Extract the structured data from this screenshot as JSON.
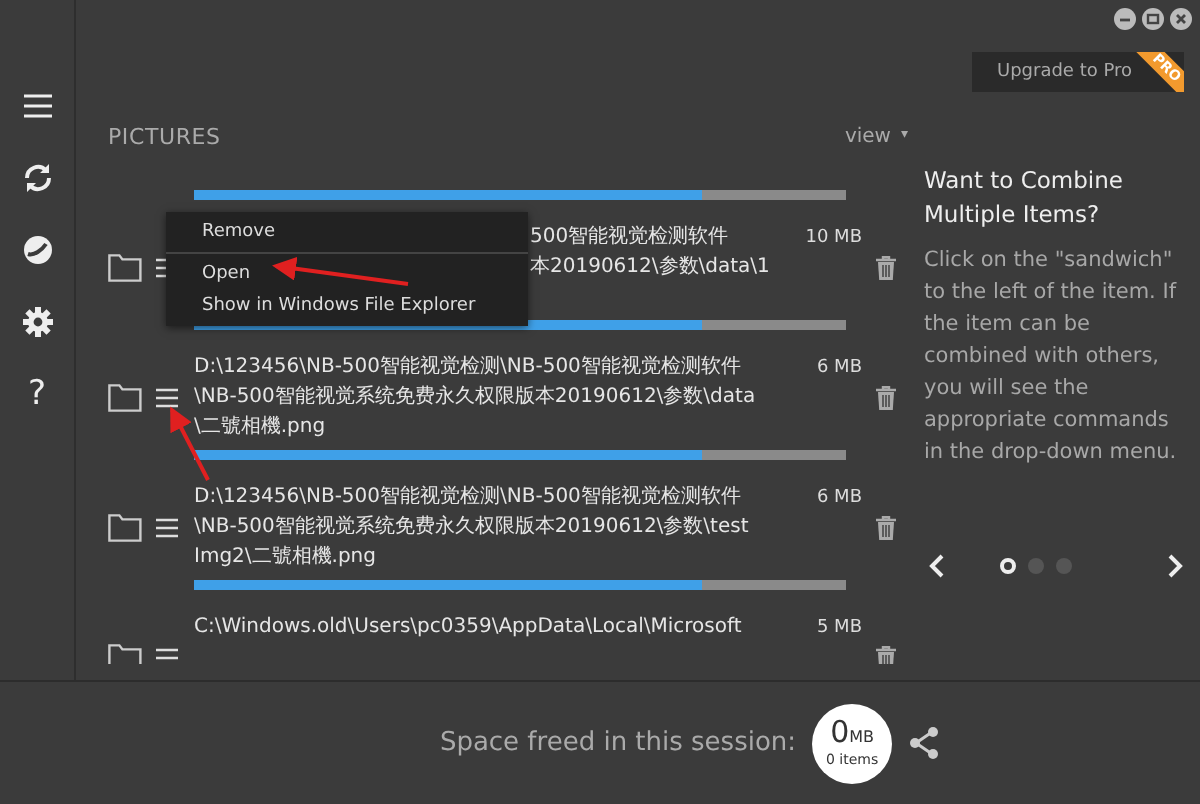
{
  "window_controls": [
    {
      "kind": "minimize"
    },
    {
      "kind": "maximize"
    },
    {
      "kind": "close"
    }
  ],
  "upgrade": {
    "label": "Upgrade to Pro",
    "badge": "PRO"
  },
  "sidebar": {
    "items": [
      {
        "kind": "menu"
      },
      {
        "kind": "refresh"
      },
      {
        "kind": "disc"
      },
      {
        "kind": "settings"
      },
      {
        "kind": "help",
        "label": "?"
      }
    ]
  },
  "section_title": "PICTURES",
  "view_menu": {
    "label": "view",
    "caret": "▾"
  },
  "items": [
    {
      "kind": "partial",
      "level": 0.78
    },
    {
      "kind": "covered",
      "lines": [
        "500智能视觉检测软件",
        "本20190612\\参数\\data\\1"
      ],
      "size": "10 MB",
      "level": 0.78
    },
    {
      "kind": "full",
      "lines": [
        "D:\\123456\\NB-500智能视觉检测\\NB-500智能视觉检测软件",
        "\\NB-500智能视觉系统免费永久权限版本20190612\\参数\\data",
        "\\二號相機.png"
      ],
      "size": "6 MB",
      "level": 0.78
    },
    {
      "kind": "full",
      "lines": [
        "D:\\123456\\NB-500智能视觉检测\\NB-500智能视觉检测软件",
        "\\NB-500智能视觉系统免费永久权限版本20190612\\参数\\test",
        "Img2\\二號相機.png"
      ],
      "size": "6 MB",
      "level": 0.78
    },
    {
      "kind": "full",
      "lines": [
        "C:\\Windows.old\\Users\\pc0359\\AppData\\Local\\Microsoft"
      ],
      "size": "5 MB"
    }
  ],
  "context_menu": {
    "items": [
      {
        "kind": "item",
        "label": "Remove"
      },
      {
        "kind": "separator"
      },
      {
        "kind": "item",
        "label": "Open"
      },
      {
        "kind": "item",
        "label": "Show in Windows File Explorer"
      }
    ]
  },
  "tip": {
    "title": "Want to Combine Multiple Items?",
    "body": "Click on the \"sandwich\" to the left of the item. If the item can be combined with others, you will see the appropriate commands in the drop-down menu.",
    "pages": [
      {
        "selected": true
      },
      {
        "selected": false
      },
      {
        "selected": false
      }
    ]
  },
  "status_bar": {
    "label": "Space freed in this session:",
    "amount": "0",
    "unit": "MB",
    "items": "0 items"
  }
}
